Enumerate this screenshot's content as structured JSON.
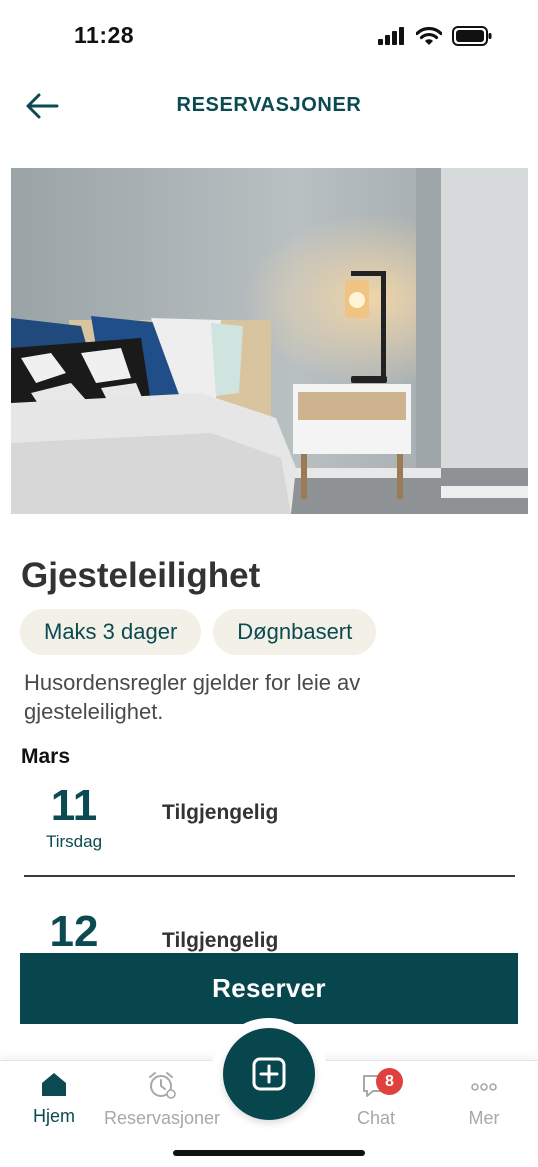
{
  "status_bar": {
    "time": "11:28"
  },
  "header": {
    "title": "RESERVASJONER"
  },
  "listing": {
    "name": "Gjesteleilighet",
    "chips": [
      "Maks 3 dager",
      "Døgnbasert"
    ],
    "description": "Husordensregler gjelder for leie av gjesteleilighet."
  },
  "calendar": {
    "month": "Mars",
    "days": [
      {
        "number": "11",
        "weekday": "Tirsdag",
        "status": "Tilgjengelig"
      },
      {
        "number": "12",
        "weekday": "",
        "status": "Tilgjengelig"
      }
    ]
  },
  "reserve_button": "Reserver",
  "tab_bar": {
    "items": [
      {
        "label": "Hjem",
        "icon": "home-icon",
        "active": true
      },
      {
        "label": "Reservasjoner",
        "icon": "alarm-clock-icon",
        "active": false
      },
      {
        "label": "Chat",
        "icon": "chat-icon",
        "active": false,
        "badge": "8"
      },
      {
        "label": "Mer",
        "icon": "more-dots-icon",
        "active": false
      }
    ],
    "fab_icon": "plus-square-icon"
  },
  "colors": {
    "brand": "#08464d",
    "chip_bg": "#f3f0e8",
    "badge": "#e0413e",
    "inactive": "#a8a8a8"
  }
}
